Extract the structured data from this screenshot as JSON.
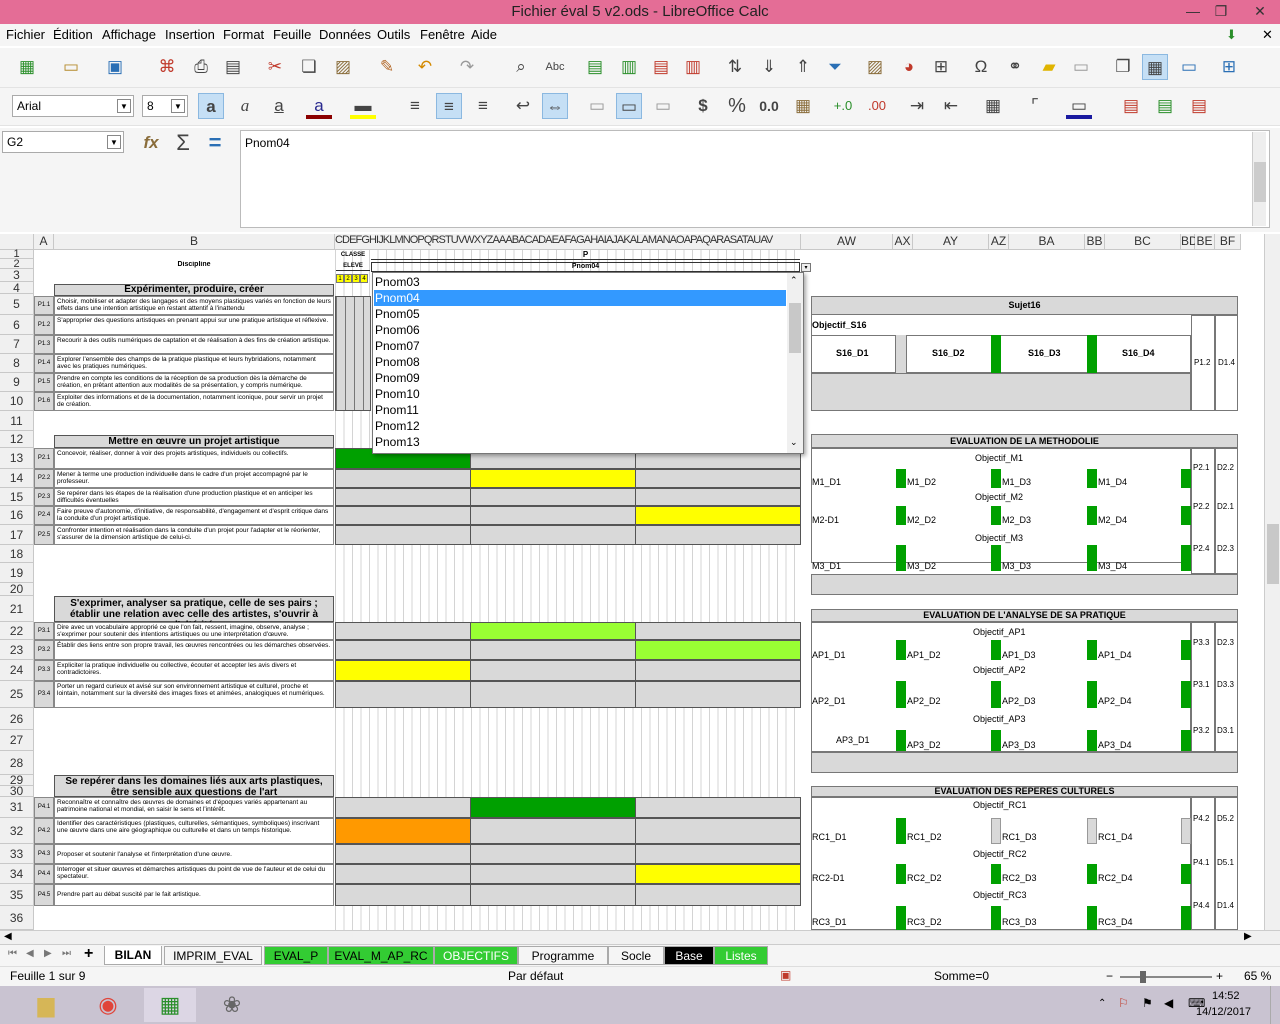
{
  "window": {
    "title": "Fichier éval 5 v2.ods - LibreOffice Calc"
  },
  "menu": [
    "Fichier",
    "Édition",
    "Affichage",
    "Insertion",
    "Format",
    "Feuille",
    "Données",
    "Outils",
    "Fenêtre",
    "Aide"
  ],
  "font": {
    "name": "Arial",
    "size": "8"
  },
  "toolbar2": {
    "currency": "$",
    "percent": "%",
    "decimal": "0.0"
  },
  "formula": {
    "cell_ref": "G2",
    "content": "Pnom04",
    "fx": "fx",
    "sum": "Σ",
    "eq": "="
  },
  "columns": [
    "A",
    "B",
    "CDEFGHIJKLMNOPQRSTUVWXYZAAABACADAEAFAGAHAIAJAKALAMANAOAPAQARASATAUAV",
    "AW",
    "AX",
    "AY",
    "AZ",
    "BA",
    "BB",
    "BC",
    "BD",
    "BE",
    "BF"
  ],
  "rows": [
    "1",
    "2",
    "3",
    "4",
    "5",
    "6",
    "7",
    "8",
    "9",
    "10",
    "11",
    "12",
    "13",
    "14",
    "15",
    "16",
    "17",
    "18",
    "19",
    "20",
    "21",
    "22",
    "23",
    "24",
    "25",
    "26",
    "27",
    "28",
    "29",
    "30",
    "31",
    "32",
    "33",
    "34",
    "35",
    "36"
  ],
  "sheet": {
    "discipline": "Discipline",
    "classe": "CLASSE",
    "eleve": "ELEVE",
    "p": "P",
    "pnom": "Pnom04",
    "nums": [
      "1",
      "2",
      "3",
      "4"
    ],
    "sections": [
      "Expérimenter, produire, créer",
      "Mettre en œuvre un projet artistique",
      "S'exprimer, analyser sa pratique, celle de ses pairs ; établir une relation avec celle des artistes, s'ouvrir à l'altérité",
      "Se repérer dans les domaines liés aux arts plastiques, être sensible aux questions de l'art"
    ],
    "items": [
      {
        "code": "P1.1",
        "text": "Choisir, mobiliser et adapter des langages et des moyens plastiques variés en fonction de leurs effets dans une intention artistique en restant attentif à l'inattendu"
      },
      {
        "code": "P1.2",
        "text": "S'approprier des questions artistiques en prenant appui sur une pratique artistique et réflexive."
      },
      {
        "code": "P1.3",
        "text": "Recourir à des outils numériques de captation et de réalisation à des fins de création artistique."
      },
      {
        "code": "P1.4",
        "text": "Explorer l'ensemble des champs de la pratique plastique et leurs hybridations, notamment avec les pratiques numériques."
      },
      {
        "code": "P1.5",
        "text": "Prendre en compte les conditions de la réception de sa production dès la démarche de création, en prêtant attention aux modalités de sa présentation, y compris numérique."
      },
      {
        "code": "P1.6",
        "text": "Exploiter des informations et de la documentation, notamment iconique, pour servir un projet de création."
      },
      {
        "code": "P2.1",
        "text": "Concevoir, réaliser, donner à voir des projets artistiques, individuels ou collectifs."
      },
      {
        "code": "P2.2",
        "text": "Mener à terme une production individuelle dans le cadre d'un projet accompagné par le professeur."
      },
      {
        "code": "P2.3",
        "text": "Se repérer dans les étapes de la réalisation d'une production plastique et en anticiper les difficultés éventuelles"
      },
      {
        "code": "P2.4",
        "text": "Faire preuve d'autonomie, d'initiative, de responsabilité, d'engagement et d'esprit critique dans la conduite d'un projet artistique."
      },
      {
        "code": "P2.5",
        "text": "Confronter intention et réalisation dans la conduite d'un projet pour l'adapter et le réorienter, s'assurer de la dimension artistique de celui-ci."
      },
      {
        "code": "P3.1",
        "text": "Dire avec un vocabulaire approprié ce que l'on fait, ressent, imagine, observe, analyse ; s'exprimer pour soutenir des intentions artistiques ou une interprétation d'œuvre."
      },
      {
        "code": "P3.2",
        "text": "Établir des liens entre son propre travail, les œuvres rencontrées ou les démarches observées."
      },
      {
        "code": "P3.3",
        "text": "Expliciter la pratique individuelle ou collective, écouter et accepter les avis divers et contradictoires."
      },
      {
        "code": "P3.4",
        "text": "Porter un regard curieux et avisé sur son environnement artistique et culturel, proche et lointain, notamment sur la diversité des images fixes et animées, analogiques et numériques."
      },
      {
        "code": "P4.1",
        "text": "Reconnaître et connaître des œuvres de domaines et d'époques variés appartenant au patrimoine national et mondial, en saisir le sens et l'intérêt."
      },
      {
        "code": "P4.2",
        "text": "Identifier des caractéristiques (plastiques, culturelles, sémantiques, symboliques) inscrivant une œuvre dans une aire géographique ou culturelle et dans un temps historique."
      },
      {
        "code": "P4.3",
        "text": "Proposer et soutenir l'analyse et l'interprétation d'une œuvre."
      },
      {
        "code": "P4.4",
        "text": "Interroger et situer œuvres et démarches artistiques du point de vue de l'auteur et de celui du spectateur."
      },
      {
        "code": "P4.5",
        "text": "Prendre part au débat suscité par le fait artistique."
      }
    ],
    "right": {
      "sujet": "Sujet16",
      "obj_s16": "Objectif_S16",
      "s16": [
        "S16_D1",
        "S16_D2",
        "S16_D3",
        "S16_D4"
      ],
      "p12": "P1.2",
      "d14": "D1.4",
      "methodo": "EVALUATION DE LA METHODOLIE",
      "m_objs": [
        "Objectif_M1",
        "Objectif_M2",
        "Objectif_M3"
      ],
      "m1": [
        "M1_D1",
        "M1_D2",
        "M1_D3",
        "M1_D4"
      ],
      "m2": [
        "M2-D1",
        "M2_D2",
        "M2_D3",
        "M2_D4"
      ],
      "m3": [
        "M3_D1",
        "M3_D2",
        "M3_D3",
        "M3_D4"
      ],
      "m_codes": [
        [
          "P2.1",
          "D2.2"
        ],
        [
          "P2.2",
          "D2.1"
        ],
        [
          "P2.4",
          "D2.3"
        ]
      ],
      "analyse": "EVALUATION DE L'ANALYSE DE SA PRATIQUE",
      "ap_objs": [
        "Objectif_AP1",
        "Objectif_AP2",
        "Objectif_AP3"
      ],
      "ap1": [
        "AP1_D1",
        "AP1_D2",
        "AP1_D3",
        "AP1_D4"
      ],
      "ap2": [
        "AP2_D1",
        "AP2_D2",
        "AP2_D3",
        "AP2_D4"
      ],
      "ap3": [
        "AP3_D1",
        "AP3_D2",
        "AP3_D3",
        "AP3_D4"
      ],
      "ap_codes": [
        [
          "P3.3",
          "D2.3"
        ],
        [
          "P3.1",
          "D3.3"
        ],
        [
          "P3.2",
          "D3.1"
        ]
      ],
      "reperes": "EVALUATION DES REPERES CULTURELS",
      "rc_objs": [
        "Objectif_RC1",
        "Objectif_RC2",
        "Objectif_RC3"
      ],
      "rc1": [
        "RC1_D1",
        "RC1_D2",
        "RC1_D3",
        "RC1_D4"
      ],
      "rc2": [
        "RC2-D1",
        "RC2_D2",
        "RC2_D3",
        "RC2_D4"
      ],
      "rc3": [
        "RC3_D1",
        "RC3_D2",
        "RC3_D3",
        "RC3_D4"
      ],
      "rc_codes": [
        [
          "P4.2",
          "D5.2"
        ],
        [
          "P4.1",
          "D5.1"
        ],
        [
          "P4.4",
          "D1.4"
        ]
      ]
    }
  },
  "dropdown": {
    "options": [
      "Pnom03",
      "Pnom04",
      "Pnom05",
      "Pnom06",
      "Pnom07",
      "Pnom08",
      "Pnom09",
      "Pnom10",
      "Pnom11",
      "Pnom12",
      "Pnom13"
    ],
    "selected": "Pnom04"
  },
  "tabs": [
    "BILAN",
    "IMPRIM_EVAL",
    "EVAL_P",
    "EVAL_M_AP_RC",
    "OBJECTIFS",
    "Programme",
    "Socle",
    "Base",
    "Listes"
  ],
  "status": {
    "sheet": "Feuille 1 sur 9",
    "style": "Par défaut",
    "sum": "Somme=0",
    "zoom": "65 %"
  },
  "clock": {
    "time": "14:52",
    "date": "14/12/2017"
  },
  "colors": {
    "title": "#e46d96",
    "green": "#00a000",
    "lightgreen": "#99ff33",
    "yellow": "#ffff00",
    "orange": "#ff9900",
    "grey": "#d9d9d9"
  }
}
